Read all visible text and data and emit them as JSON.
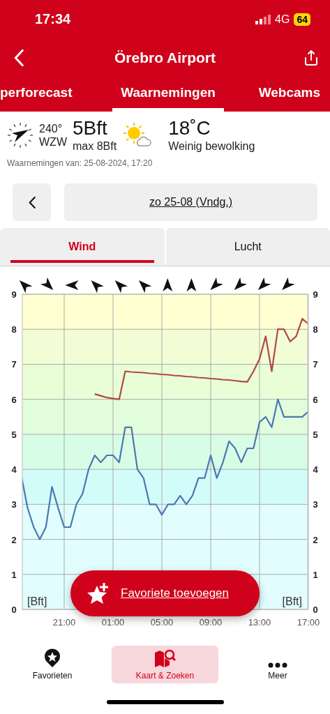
{
  "status_bar": {
    "time": "17:34",
    "network": "4G",
    "battery": "64"
  },
  "nav_bar": {
    "title": "Örebro Airport"
  },
  "tabs": [
    {
      "label": "perforecast",
      "selected": false
    },
    {
      "label": "Waarnemingen",
      "selected": true
    },
    {
      "label": "Webcams",
      "selected": false
    }
  ],
  "current": {
    "direction_degrees": "240°",
    "direction_name": "WZW",
    "wind": "5Bft",
    "wind_max": "max 8Bft",
    "temperature": "18˚C",
    "condition": "Weinig bewolking"
  },
  "observed_at": "Waarnemingen van: 25-08-2024, 17:20",
  "date_nav": {
    "date": "zo 25-08 (Vndg.)"
  },
  "segments": [
    {
      "label": "Wind",
      "selected": true
    },
    {
      "label": "Lucht",
      "selected": false
    }
  ],
  "chart": {
    "right_yticks": [
      "9",
      "8",
      "7",
      "6",
      "5",
      "4",
      "3",
      "2",
      "1",
      "0"
    ],
    "left_label": "[Bft]",
    "right_label": "[Bft]",
    "chart_data": {
      "type": "line",
      "ylim": [
        0,
        9
      ],
      "yticks": [
        {
          "value": 0,
          "label": "0"
        },
        {
          "value": 1,
          "label": "1"
        },
        {
          "value": 2,
          "label": "2"
        },
        {
          "value": 3,
          "label": "3"
        },
        {
          "value": 4,
          "label": "4"
        },
        {
          "value": 5,
          "label": "5"
        },
        {
          "value": 6,
          "label": "6"
        },
        {
          "value": 7,
          "label": "7"
        },
        {
          "value": 8,
          "label": "8"
        },
        {
          "value": 9,
          "label": "9"
        }
      ],
      "grid": true,
      "categories": [
        null,
        null,
        null,
        null,
        null,
        null,
        null,
        "21:00",
        null,
        null,
        null,
        null,
        null,
        null,
        null,
        "01:00",
        null,
        null,
        null,
        null,
        null,
        null,
        null,
        "05:00",
        null,
        null,
        null,
        null,
        null,
        null,
        null,
        "09:00",
        null,
        null,
        null,
        null,
        null,
        null,
        null,
        "13:00",
        null,
        null,
        null,
        null,
        null,
        null,
        null,
        "17:00"
      ],
      "series": [
        {
          "color": "#4a78b0",
          "values": [
            3.8,
            2.9,
            2.35,
            2.0,
            2.35,
            3.5,
            2.9,
            2.35,
            2.35,
            3.0,
            3.3,
            4.0,
            4.4,
            4.2,
            4.4,
            4.4,
            4.2,
            5.2,
            5.2,
            4.0,
            3.75,
            3.0,
            3.0,
            2.7,
            3.0,
            3.0,
            3.25,
            3.0,
            3.25,
            3.75,
            3.75,
            4.4,
            3.75,
            4.2,
            4.8,
            4.6,
            4.2,
            4.6,
            4.6,
            5.35,
            5.5,
            5.2,
            6.0,
            5.5,
            5.5,
            5.5,
            5.5,
            5.65
          ]
        },
        {
          "color": "#b04848",
          "values": [
            null,
            null,
            null,
            null,
            null,
            null,
            null,
            null,
            null,
            null,
            null,
            null,
            6.15,
            6.1,
            6.05,
            6.02,
            6.0,
            6.8,
            6.78,
            6.77,
            6.76,
            6.74,
            6.73,
            6.71,
            6.7,
            6.68,
            6.67,
            6.65,
            6.64,
            6.62,
            6.61,
            6.59,
            6.58,
            6.56,
            6.55,
            6.53,
            6.51,
            6.5,
            6.8,
            7.15,
            7.8,
            6.8,
            8.0,
            8.0,
            7.65,
            7.8,
            8.3,
            8.15
          ]
        }
      ]
    }
  },
  "fab": {
    "label": "Favoriete toevoegen"
  },
  "bottom_nav": [
    {
      "label": "Favorieten",
      "kind": "favorites",
      "selected": false
    },
    {
      "label": "Kaart & Zoeken",
      "kind": "map",
      "selected": true
    },
    {
      "label": "Meer",
      "kind": "more",
      "selected": false
    }
  ]
}
